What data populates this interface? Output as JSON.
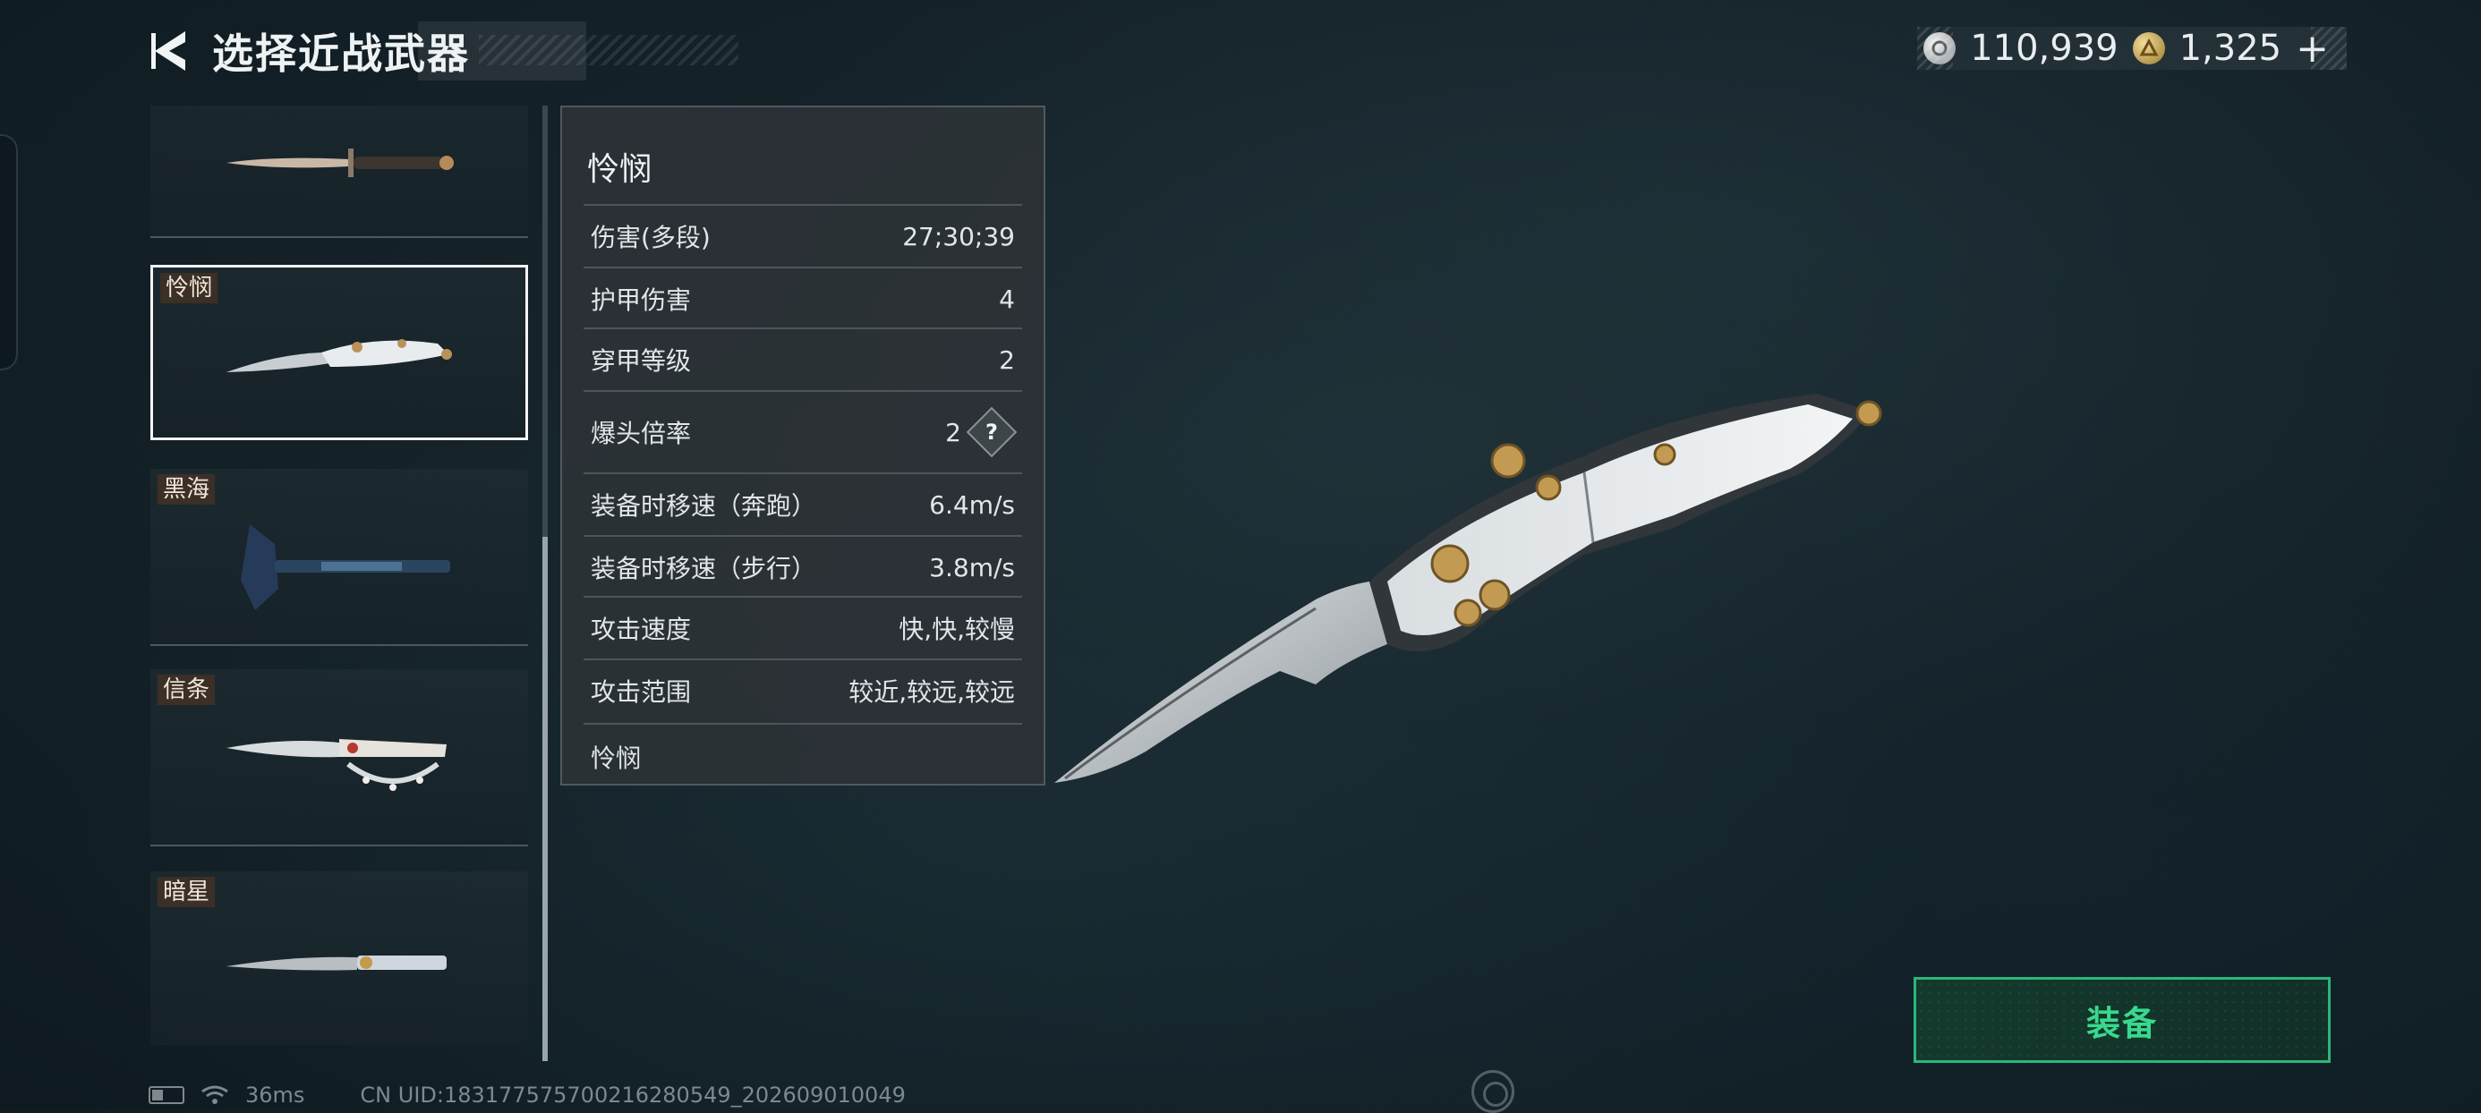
{
  "header": {
    "title": "选择近战武器",
    "back_icon": "back-arrow-icon"
  },
  "currency": {
    "silver": {
      "icon": "silver-coin-icon",
      "value": "110,939"
    },
    "gold": {
      "icon": "gold-coin-icon",
      "value": "1,325"
    },
    "add_label": "+"
  },
  "weapons": [
    {
      "tag": "",
      "icon": "dagger-icon"
    },
    {
      "tag": "怜悯",
      "icon": "folding-knife-icon",
      "selected": true
    },
    {
      "tag": "黑海",
      "icon": "axe-icon"
    },
    {
      "tag": "信条",
      "icon": "knuckle-knife-icon"
    },
    {
      "tag": "暗星",
      "icon": "blade-icon"
    }
  ],
  "stats": {
    "name": "怜悯",
    "rows": [
      {
        "label": "伤害(多段)",
        "value": "27;30;39"
      },
      {
        "label": "护甲伤害",
        "value": "4"
      },
      {
        "label": "穿甲等级",
        "value": "2"
      },
      {
        "label": "爆头倍率",
        "value": "2",
        "help": "?"
      },
      {
        "label": "装备时移速（奔跑）",
        "value": "6.4m/s"
      },
      {
        "label": "装备时移速（步行）",
        "value": "3.8m/s"
      },
      {
        "label": "攻击速度",
        "value": "快,快,较慢"
      },
      {
        "label": "攻击范围",
        "value": "较近,较远,较远"
      }
    ],
    "description": "怜悯"
  },
  "equip_button": {
    "label": "装备"
  },
  "footer": {
    "ping": "36ms",
    "uid": "CN UID:18317757570021628​0549_202609010049"
  },
  "colors": {
    "accent_green": "#38d98e",
    "tag_bg": "#3b2f26",
    "selected_border": "#f2f4f5"
  }
}
